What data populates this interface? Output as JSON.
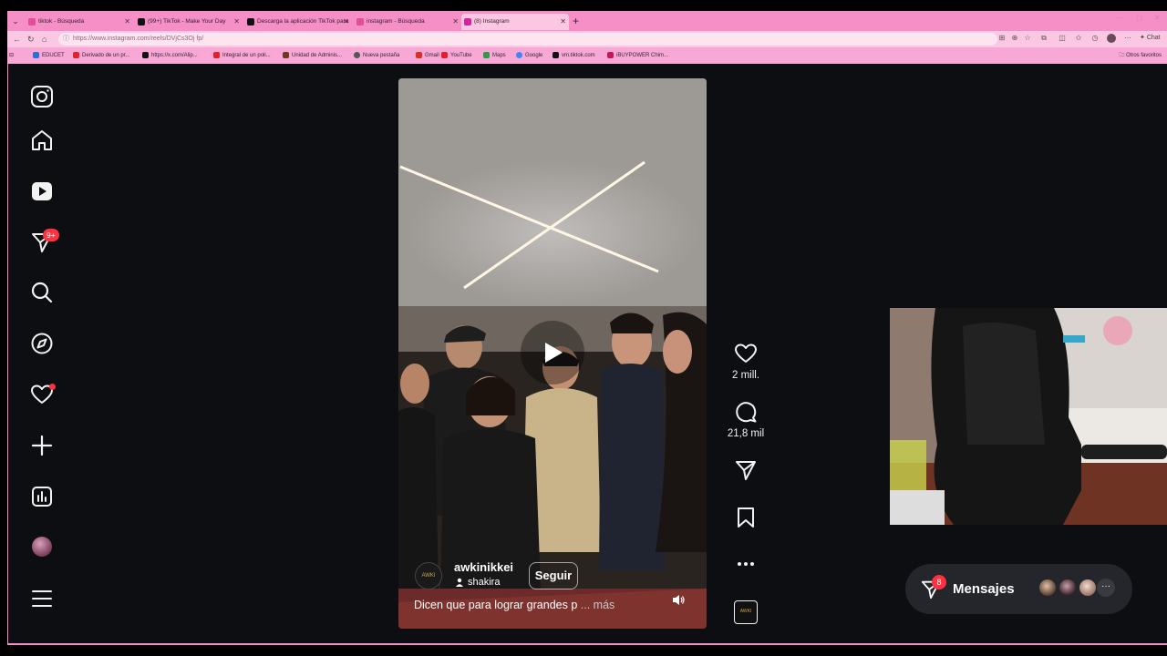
{
  "browser": {
    "tabs": [
      {
        "label": "tiktok - Búsqueda",
        "color": "#e44d9a"
      },
      {
        "label": "(99+) TikTok - Make Your Day",
        "color": "#111111"
      },
      {
        "label": "Descarga la aplicación TikTok para",
        "color": "#111111"
      },
      {
        "label": "instagram - Búsqueda",
        "color": "#e44d9a"
      },
      {
        "label": "(8) Instagram",
        "color": "#d6249f"
      }
    ],
    "url": "https://www.instagram.com/reels/DVjCs3Oj fp/",
    "chat_label": "Chat",
    "bookmarks": [
      {
        "label": "EDUCET",
        "color": "#2e6fd6"
      },
      {
        "label": "Derivado de un pr...",
        "color": "#e0202a"
      },
      {
        "label": "https://x.com/Alip...",
        "color": "#111111"
      },
      {
        "label": "Integral de un poli...",
        "color": "#e0202a"
      },
      {
        "label": "Unidad de Adminis...",
        "color": "#6d3b1f"
      },
      {
        "label": "Nueva pestaña",
        "color": "#555555"
      },
      {
        "label": "Gmail",
        "color": "#d93025"
      },
      {
        "label": "YouTube",
        "color": "#e0202a"
      },
      {
        "label": "Maps",
        "color": "#2e9b4a"
      },
      {
        "label": "Google",
        "color": "#4285f4"
      },
      {
        "label": "vm.tiktok.com",
        "color": "#111111"
      },
      {
        "label": "iBUYPOWER Chim...",
        "color": "#c2185b"
      }
    ],
    "other_favorites": "Otros favoritos"
  },
  "sidebar": {
    "notifications_badge": "9+"
  },
  "reel": {
    "username": "awkinikkei",
    "audio": "shakira",
    "follow_label": "Seguir",
    "caption": "Dicen que para lograr grandes p",
    "caption_more": "... más",
    "avatar_text": "AWKI",
    "likes": "2 mill.",
    "comments": "21,8 mil"
  },
  "messages": {
    "label": "Mensajes",
    "badge": "8"
  }
}
